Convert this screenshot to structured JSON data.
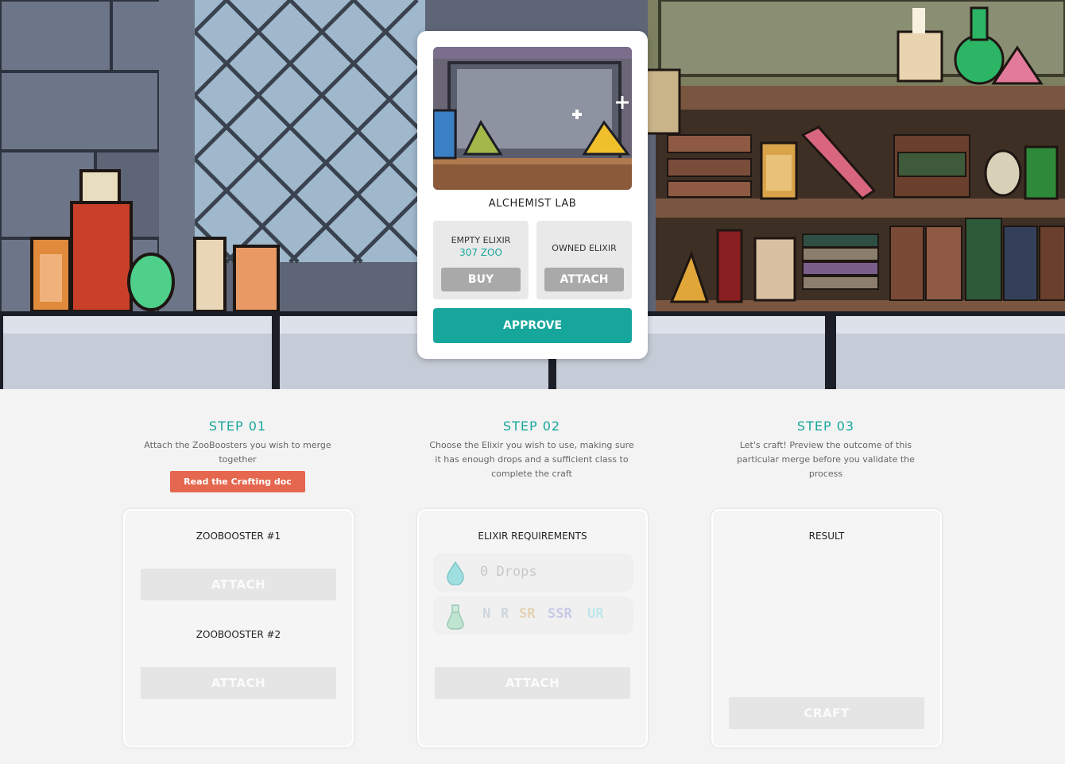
{
  "lab": {
    "title": "ALCHEMIST LAB",
    "empty_elixir": {
      "label": "EMPTY ELIXIR",
      "price": "307 ZOO",
      "button": "BUY"
    },
    "owned_elixir": {
      "label": "OWNED ELIXIR",
      "button": "ATTACH"
    },
    "approve": "APPROVE"
  },
  "steps": [
    {
      "title": "STEP 01",
      "text": "Attach the ZooBoosters you wish to merge together",
      "link": "Read the Crafting doc"
    },
    {
      "title": "STEP 02",
      "text": "Choose the Elixir you wish to use, making sure it has enough drops and a sufficient class to complete the craft"
    },
    {
      "title": "STEP 03",
      "text": "Let's craft! Preview the outcome of this particular merge before you validate the process"
    }
  ],
  "panels": {
    "booster1": {
      "title": "ZOOBOOSTER #1",
      "button": "ATTACH"
    },
    "booster2": {
      "title": "ZOOBOOSTER #2",
      "button": "ATTACH"
    },
    "elixir": {
      "title": "ELIXIR REQUIREMENTS",
      "drops": "0 Drops",
      "ranks": [
        "N",
        "R",
        "SR",
        "SSR",
        "UR"
      ],
      "rank_colors": [
        "#cfd6dd",
        "#cfd6dd",
        "#e4d3b4",
        "#c7cbe8",
        "#bfe6ea"
      ],
      "button": "ATTACH"
    },
    "result": {
      "title": "RESULT",
      "button": "CRAFT"
    }
  },
  "icons": [
    "drop-icon",
    "flask-icon"
  ],
  "colors": {
    "accent": "#16a69c",
    "doc_button": "#e5674f",
    "disabled": "#a9a9a9"
  }
}
